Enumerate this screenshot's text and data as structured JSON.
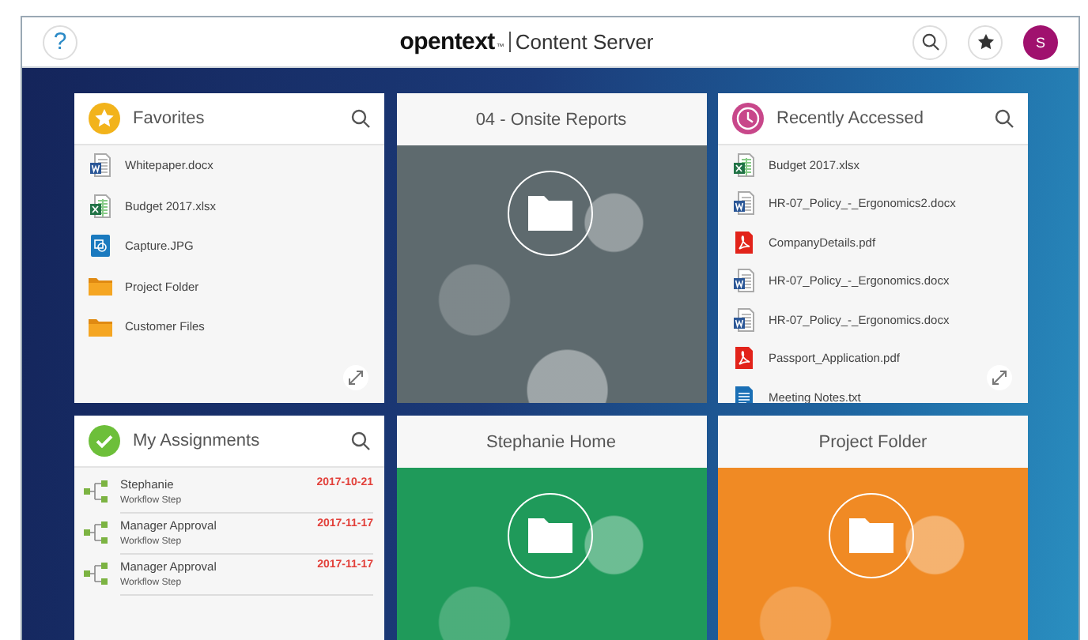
{
  "header": {
    "help": "?",
    "logo": "opentext",
    "trademark": "™",
    "product": "Content Server",
    "avatar": "S"
  },
  "tiles": [
    {
      "kind": "favorites",
      "title": "Favorites",
      "items": [
        {
          "kind": "word",
          "name": "Whitepaper.docx"
        },
        {
          "kind": "excel",
          "name": "Budget 2017.xlsx"
        },
        {
          "kind": "image",
          "name": "Capture.JPG"
        },
        {
          "kind": "folder",
          "name": "Project Folder"
        },
        {
          "kind": "folder",
          "name": "Customer Files"
        }
      ]
    },
    {
      "kind": "folder",
      "title": "04 - Onsite Reports",
      "color": "#5e6a6e"
    },
    {
      "kind": "recent",
      "title": "Recently Accessed",
      "items": [
        {
          "kind": "excel",
          "name": "Budget 2017.xlsx"
        },
        {
          "kind": "word",
          "name": "HR-07_Policy_-_Ergonomics2.docx"
        },
        {
          "kind": "pdf",
          "name": "CompanyDetails.pdf"
        },
        {
          "kind": "word",
          "name": "HR-07_Policy_-_Ergonomics.docx"
        },
        {
          "kind": "word",
          "name": "HR-07_Policy_-_Ergonomics.docx"
        },
        {
          "kind": "pdf",
          "name": "Passport_Application.pdf"
        },
        {
          "kind": "text",
          "name": "Meeting Notes.txt"
        }
      ]
    },
    {
      "kind": "assignments",
      "title": "My Assignments",
      "items": [
        {
          "name": "Stephanie",
          "step": "Workflow Step",
          "date": "2017-10-21"
        },
        {
          "name": "Manager Approval",
          "step": "Workflow Step",
          "date": "2017-11-17"
        },
        {
          "name": "Manager Approval",
          "step": "Workflow Step",
          "date": "2017-11-17"
        }
      ]
    },
    {
      "kind": "folder",
      "title": "Stephanie Home",
      "color": "#1f9a5a"
    },
    {
      "kind": "folder",
      "title": "Project Folder",
      "color": "#f08a24"
    }
  ]
}
